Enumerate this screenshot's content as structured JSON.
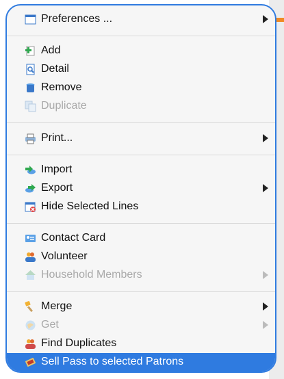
{
  "menu": {
    "items": [
      {
        "id": "preferences",
        "label": "Preferences ...",
        "submenu": true,
        "disabled": false,
        "icon": "window-icon"
      },
      {
        "id": "add",
        "label": "Add",
        "submenu": false,
        "disabled": false,
        "icon": "add-icon"
      },
      {
        "id": "detail",
        "label": "Detail",
        "submenu": false,
        "disabled": false,
        "icon": "detail-icon"
      },
      {
        "id": "remove",
        "label": "Remove",
        "submenu": false,
        "disabled": false,
        "icon": "trash-icon"
      },
      {
        "id": "duplicate",
        "label": "Duplicate",
        "submenu": false,
        "disabled": true,
        "icon": "duplicate-icon"
      },
      {
        "id": "print",
        "label": "Print...",
        "submenu": true,
        "disabled": false,
        "icon": "print-icon"
      },
      {
        "id": "import",
        "label": "Import",
        "submenu": false,
        "disabled": false,
        "icon": "import-icon"
      },
      {
        "id": "export",
        "label": "Export",
        "submenu": true,
        "disabled": false,
        "icon": "export-icon"
      },
      {
        "id": "hide-selected-lines",
        "label": "Hide Selected Lines",
        "submenu": false,
        "disabled": false,
        "icon": "hide-lines-icon"
      },
      {
        "id": "contact-card",
        "label": "Contact Card",
        "submenu": false,
        "disabled": false,
        "icon": "contact-card-icon"
      },
      {
        "id": "volunteer",
        "label": "Volunteer",
        "submenu": false,
        "disabled": false,
        "icon": "volunteer-icon"
      },
      {
        "id": "household-members",
        "label": "Household Members",
        "submenu": true,
        "disabled": true,
        "icon": "household-icon"
      },
      {
        "id": "merge",
        "label": "Merge",
        "submenu": true,
        "disabled": false,
        "icon": "merge-icon"
      },
      {
        "id": "get",
        "label": "Get",
        "submenu": true,
        "disabled": true,
        "icon": "get-icon"
      },
      {
        "id": "find-duplicates",
        "label": "Find Duplicates",
        "submenu": false,
        "disabled": false,
        "icon": "find-duplicates-icon"
      },
      {
        "id": "sell-pass",
        "label": "Sell Pass to selected Patrons",
        "submenu": false,
        "disabled": false,
        "highlighted": true,
        "icon": "ticket-icon"
      }
    ]
  },
  "colors": {
    "highlight": "#2f7be0",
    "menu_bg": "#f6f6f6",
    "disabled_text": "#a9a9a9",
    "accent": "#f08a24"
  }
}
